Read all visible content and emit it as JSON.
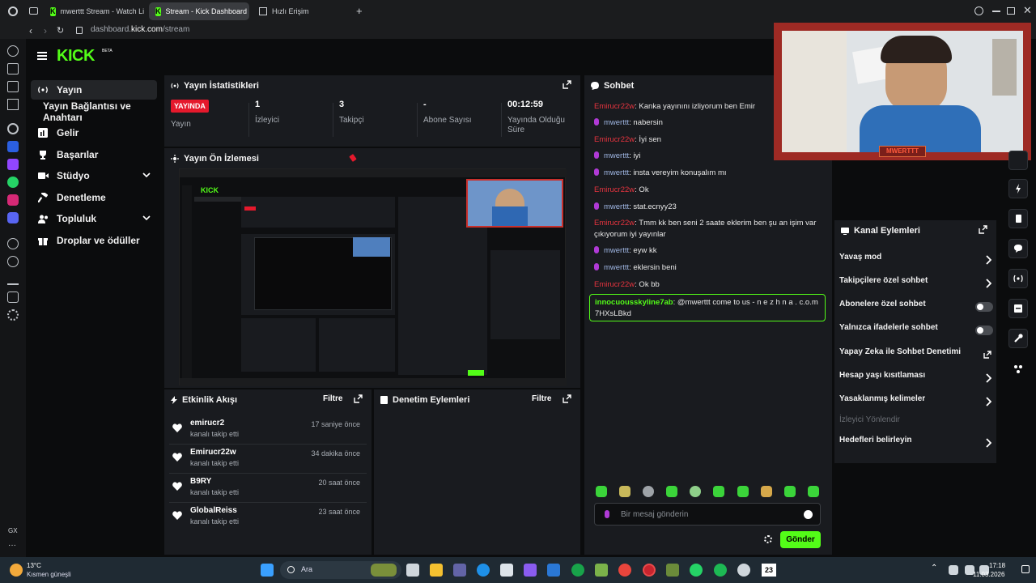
{
  "browser": {
    "tabs": [
      {
        "label": "mwerttt Stream - Watch Li"
      },
      {
        "label": "Stream - Kick Dashboard"
      },
      {
        "label": "Hızlı Erişim"
      }
    ],
    "url_prefix": "dashboard.",
    "url_domain": "kick.com",
    "url_path": "/stream"
  },
  "left_rail": {
    "gx_label": "GX"
  },
  "brand": {
    "logo": "KICK",
    "beta": "BETA",
    "accent": "#53fc18"
  },
  "sidebar": {
    "items": [
      {
        "label": "Yayın",
        "icon": "broadcast-icon"
      },
      {
        "label": "Yayın Bağlantısı ve Anahtarı"
      },
      {
        "label": "Gelir",
        "icon": "chart-icon"
      },
      {
        "label": "Başarılar",
        "icon": "trophy-icon"
      },
      {
        "label": "Stüdyo",
        "icon": "video-icon"
      },
      {
        "label": "Denetleme",
        "icon": "hammer-icon"
      },
      {
        "label": "Topluluk",
        "icon": "users-icon"
      },
      {
        "label": "Droplar ve ödüller",
        "icon": "gift-icon"
      }
    ]
  },
  "stats": {
    "title": "Yayın İstatistikleri",
    "live_badge": "YAYINDA",
    "items": [
      {
        "label": "Yayın"
      },
      {
        "value": "1",
        "label": "İzleyici"
      },
      {
        "value": "3",
        "label": "Takipçi"
      },
      {
        "value": "-",
        "label": "Abone Sayısı"
      },
      {
        "value": "00:12:59",
        "label": "Yayında Olduğu Süre"
      }
    ]
  },
  "preview": {
    "title": "Yayın Ön İzlemesi"
  },
  "activity": {
    "title": "Etkinlik Akışı",
    "filter": "Filtre",
    "items": [
      {
        "name": "emirucr2",
        "sub": "kanalı takip etti",
        "time": "17 saniye önce"
      },
      {
        "name": "Emirucr22w",
        "sub": "kanalı takip etti",
        "time": "34 dakika önce"
      },
      {
        "name": "B9RY",
        "sub": "kanalı takip etti",
        "time": "20 saat önce"
      },
      {
        "name": "GlobalReiss",
        "sub": "kanalı takip etti",
        "time": "23 saat önce"
      }
    ]
  },
  "moderation": {
    "title": "Denetim Eylemleri",
    "filter": "Filtre"
  },
  "chat": {
    "title": "Sohbet",
    "messages": [
      {
        "user": "Emirucr22w",
        "text": ": Kanka yayınını izliyorum ben Emir",
        "style": "red"
      },
      {
        "user": "mwerttt",
        "text": ": nabersin",
        "style": "mic"
      },
      {
        "user": "Emirucr22w",
        "text": ": İyi sen",
        "style": "red"
      },
      {
        "user": "mwerttt",
        "text": ": iyi",
        "style": "mic"
      },
      {
        "user": "mwerttt",
        "text": ": insta vereyim konuşalım mı",
        "style": "mic"
      },
      {
        "user": "Emirucr22w",
        "text": ": Ok",
        "style": "red"
      },
      {
        "user": "mwerttt",
        "text": ": stat.ecnyy23",
        "style": "mic"
      },
      {
        "user": "Emirucr22w",
        "text": ": Tmm kk ben seni 2 saate eklerim ben şu an işim var çıkıyorum iyi yayınlar",
        "style": "red"
      },
      {
        "user": "mwerttt",
        "text": ": eyw kk",
        "style": "mic"
      },
      {
        "user": "mwerttt",
        "text": ": eklersin beni",
        "style": "mic"
      },
      {
        "user": "Emirucr22w",
        "text": ": Ok bb",
        "style": "red"
      }
    ],
    "highlight": {
      "user": "innocuousskyline7ab",
      "text": ": @mwerttt come to us - n e z h n a . c.o.m 7HXsLBkd"
    },
    "input_placeholder": "Bir mesaj gönderin",
    "send_label": "Gönder"
  },
  "webcam": {
    "banner": "MWERTTT"
  },
  "channel_actions": {
    "title": "Kanal Eylemleri",
    "items": [
      {
        "label": "Yavaş mod",
        "control": "chevron"
      },
      {
        "label": "Takipçilere özel sohbet",
        "control": "chevron"
      },
      {
        "label": "Abonelere özel sohbet",
        "control": "toggle",
        "state": "off"
      },
      {
        "label": "Yalnızca ifadelerle sohbet",
        "control": "toggle",
        "state": "off"
      },
      {
        "label": "Yapay Zeka ile Sohbet Denetimi",
        "control": "external"
      },
      {
        "label": "Hesap yaşı kısıtlaması",
        "control": "chevron"
      },
      {
        "label": "Yasaklanmış kelimeler",
        "control": "chevron"
      },
      {
        "label": "İzleyici Yönlendir",
        "control": "none",
        "disabled": true
      },
      {
        "label": "Hedefleri belirleyin",
        "control": "chevron"
      }
    ]
  },
  "taskbar": {
    "weather_temp": "13°C",
    "weather_desc": "Kısmen güneşli",
    "search_label": "Ara",
    "time": "17:18",
    "date": "11.03.2026",
    "badge": "23"
  }
}
